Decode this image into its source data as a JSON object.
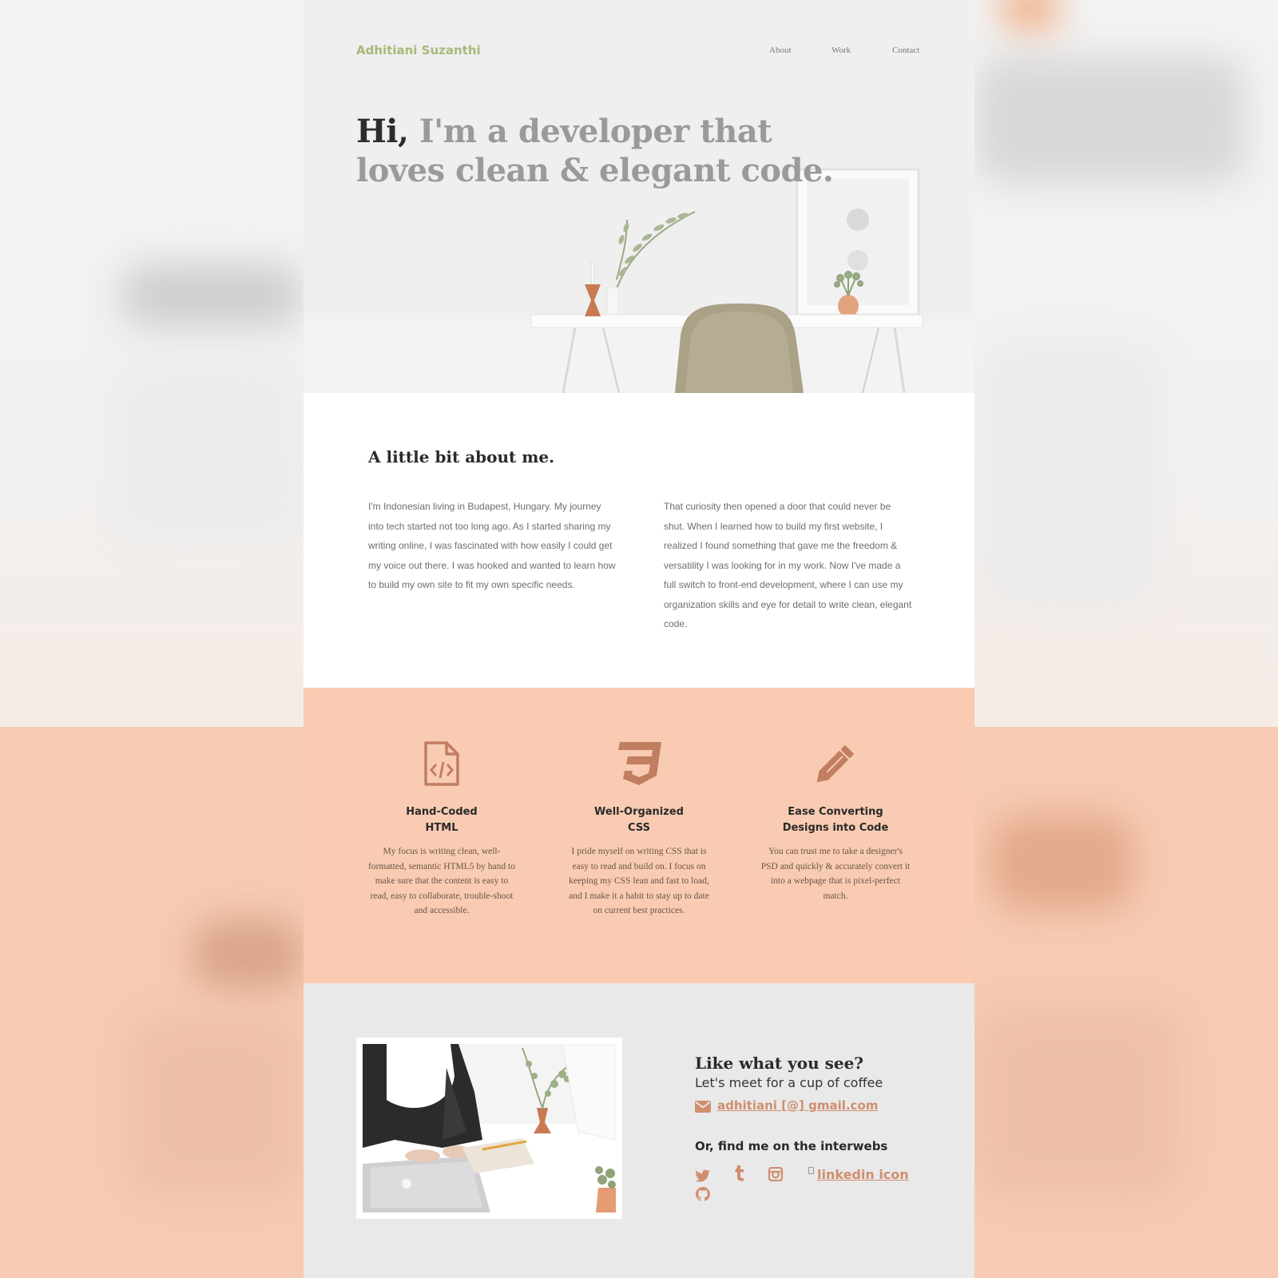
{
  "site": {
    "brand": "Adhitiani Suzanthi",
    "nav": [
      "About",
      "Work",
      "Contact"
    ]
  },
  "hero": {
    "greeting": "Hi,",
    "headline_rest": " I'm a developer that loves clean & elegant code."
  },
  "about": {
    "title": "A little bit about me.",
    "paragraph_left": "I'm Indonesian living in Budapest, Hungary. My journey into tech started not too long ago. As I started sharing my writing online, I was fascinated with how easily I could get my voice out there. I was hooked and wanted to learn how to build my own site to fit my own specific needs.",
    "paragraph_right": "That curiosity then opened a door that could never be shut. When I learned how to build my first website, I realized I found something that gave me the freedom & versatility I was looking for in my work. Now I've made a full switch to front-end development, where I can use my organization skills and eye for detail to write clean, elegant code."
  },
  "skills": [
    {
      "icon": "file-code-icon",
      "title_line1": "Hand-Coded",
      "title_line2": "HTML",
      "description": "My focus is writing clean, well-formatted, semantic HTML5 by hand to make sure that the content is easy to read, easy to collaborate, trouble-shoot and accessible."
    },
    {
      "icon": "css3-icon",
      "title_line1": "Well-Organized",
      "title_line2": "CSS",
      "description": "I pride myself on writing CSS that is easy to read and build on. I focus on keeping my CSS lean and fast to load, and I make it a habit to stay up to date on current best practices."
    },
    {
      "icon": "pencil-icon",
      "title_line1": "Ease Converting",
      "title_line2": "Designs into Code",
      "description": "You can trust me to take a designer's PSD and quickly & accurately convert it into a webpage that is pixel-perfect match."
    }
  ],
  "contact": {
    "title": "Like what you see?",
    "subtitle": "Let's meet for a cup of coffee",
    "email": "adhitiani [@] gmail.com",
    "find_title": "Or, find me on the interwebs",
    "socials": [
      "twitter-icon",
      "tumblr-icon",
      "instagram-icon",
      "github-icon"
    ],
    "linkedin_alt": "linkedin icon"
  },
  "colors": {
    "accent": "#d08e6e",
    "brand_green": "#a8b87a",
    "skills_bg": "#f8cbb2",
    "contact_bg": "#e9e9e9"
  }
}
